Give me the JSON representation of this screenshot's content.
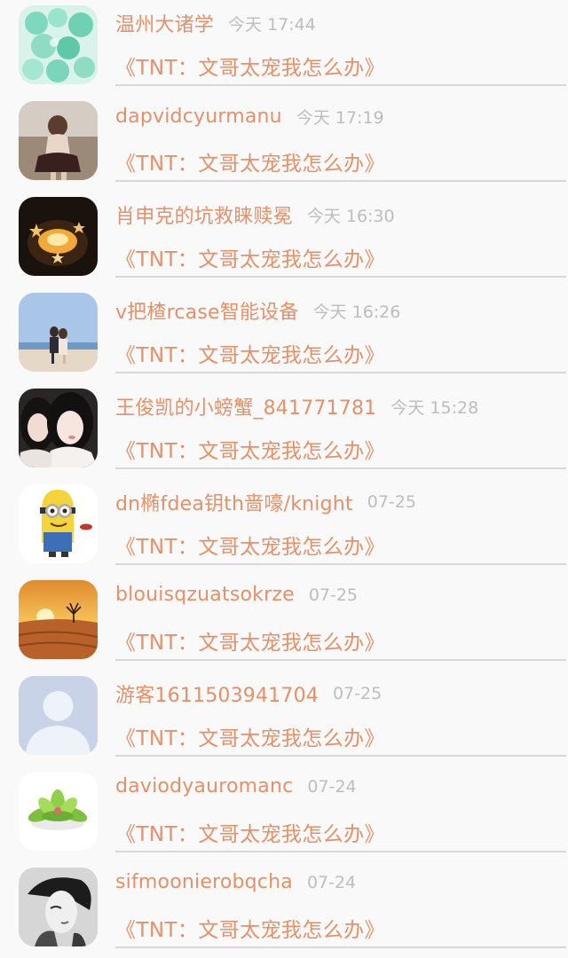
{
  "items": [
    {
      "name": "温州大诸学",
      "time": "今天 17:44",
      "title": "《TNT：文哥太宠我怎么办》",
      "avatar": "mint-candy-avatar"
    },
    {
      "name": "dapvidcyurmanu",
      "time": "今天 17:19",
      "title": "《TNT：文哥太宠我怎么办》",
      "avatar": "girl-in-field-avatar"
    },
    {
      "name": "肖申克的坑救睐赎冕",
      "time": "今天 16:30",
      "title": "《TNT：文哥太宠我怎么办》",
      "avatar": "star-candle-avatar"
    },
    {
      "name": "v把楂rcase智能设备",
      "time": "今天 16:26",
      "title": "《TNT：文哥太宠我怎么办》",
      "avatar": "beach-couple-avatar"
    },
    {
      "name": "王俊凯的小螃蟹_841771781",
      "time": "今天 15:28",
      "title": "《TNT：文哥太宠我怎么办》",
      "avatar": "two-girls-avatar"
    },
    {
      "name": "dn椭fdea钥th啬嚎/knight",
      "time": "07-25",
      "title": "《TNT：文哥太宠我怎么办》",
      "avatar": "minion-avatar"
    },
    {
      "name": "blouisqzuatsokrze",
      "time": "07-25",
      "title": "《TNT：文哥太宠我怎么办》",
      "avatar": "desert-sunset-avatar"
    },
    {
      "name": "游客1611503941704",
      "time": "07-25",
      "title": "《TNT：文哥太宠我怎么办》",
      "avatar": "default-user-avatar"
    },
    {
      "name": "daviodyauromanc",
      "time": "07-24",
      "title": "《TNT：文哥太宠我怎么办》",
      "avatar": "succulent-avatar"
    },
    {
      "name": "sifmoonierobqcha",
      "time": "07-24",
      "title": "《TNT：文哥太宠我怎么办》",
      "avatar": "bw-portrait-avatar"
    }
  ]
}
